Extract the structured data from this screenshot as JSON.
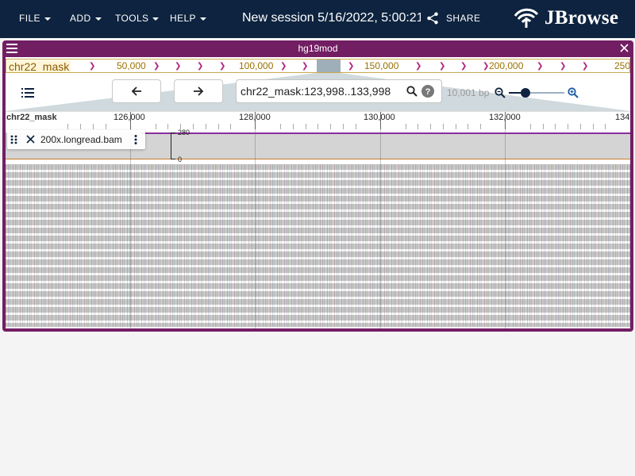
{
  "menu": {
    "file": "FILE",
    "add": "ADD",
    "tools": "TOOLS",
    "help": "HELP"
  },
  "session": {
    "title": "New session 5/16/2022, 5:00:21 PM"
  },
  "share": {
    "label": "SHARE"
  },
  "logo": {
    "text": "JBrowse"
  },
  "view": {
    "title": "hg19mod",
    "overview": {
      "chromosome": "chr22_mask",
      "ticks": [
        "50,000",
        "100,000",
        "150,000",
        "200,000",
        "250"
      ]
    },
    "location": {
      "value": "chr22_mask:123,998..133,998"
    },
    "bp_label": "10,001 bp",
    "zoom_level": 0.3,
    "ruler": {
      "chromosome": "chr22_mask",
      "ticks": [
        "126,000",
        "128,000",
        "130,000",
        "132,000",
        "134"
      ]
    }
  },
  "track": {
    "name": "200x.longread.bam",
    "axis_max": "280",
    "axis_min": "0"
  },
  "icons": {
    "dropdown": "chevron-down-icon",
    "share": "share-icon",
    "view_menu": "hamburger-icon",
    "close": "close-icon",
    "tracks": "track-selector-icon",
    "back": "arrow-left-icon",
    "forward": "arrow-right-icon",
    "search": "search-icon",
    "help": "help-icon",
    "zoom_out": "zoom-out-icon",
    "zoom_in": "zoom-in-icon",
    "drag": "drag-handle-icon",
    "track_menu": "more-vert-icon"
  },
  "colors": {
    "appbar": "#0d233f",
    "view_frame": "#721e63",
    "coverage_top": "#8a2e9e",
    "coverage_bottom": "#c77a2a"
  }
}
